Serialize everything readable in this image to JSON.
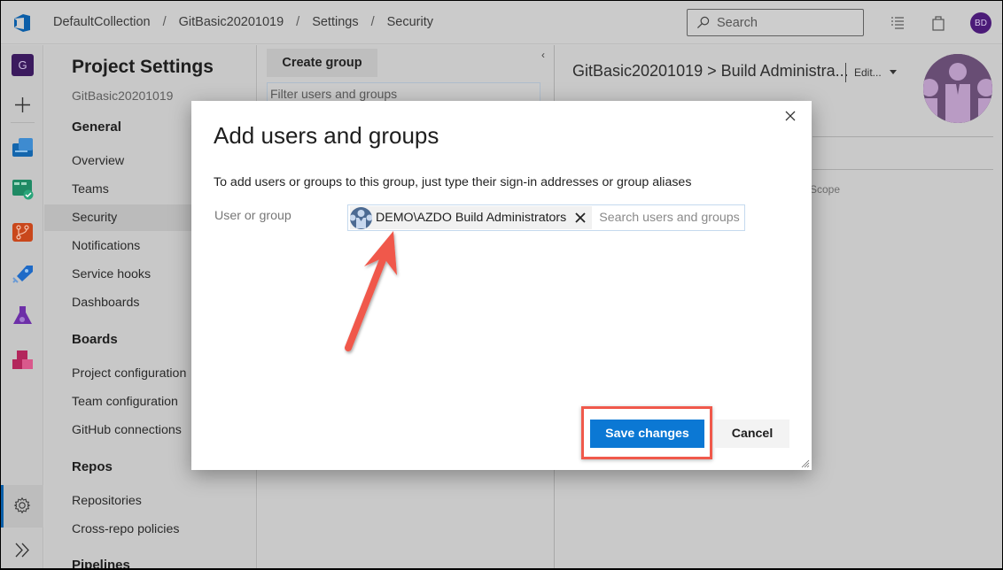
{
  "topbar": {
    "breadcrumbs": [
      "DefaultCollection",
      "GitBasic20201019",
      "Settings",
      "Security"
    ],
    "separator": "/",
    "search_placeholder": "Search",
    "user_initials": "BD"
  },
  "rail": {
    "org_initial": "G",
    "items": [
      "overview",
      "boards",
      "repos",
      "pipelines",
      "test-plans",
      "artifacts"
    ]
  },
  "nav": {
    "title": "Project Settings",
    "project": "GitBasic20201019",
    "sections": [
      {
        "heading": "General",
        "items": [
          "Overview",
          "Teams",
          "Security",
          "Notifications",
          "Service hooks",
          "Dashboards"
        ]
      },
      {
        "heading": "Boards",
        "items": [
          "Project configuration",
          "Team configuration",
          "GitHub connections"
        ]
      },
      {
        "heading": "Repos",
        "items": [
          "Repositories",
          "Cross-repo policies"
        ]
      },
      {
        "heading": "Pipelines",
        "items": []
      }
    ],
    "active_item": "Security"
  },
  "middle": {
    "create_group_label": "Create group",
    "filter_placeholder": "Filter users and groups",
    "collapse_glyph": "‹"
  },
  "right": {
    "group_path": "GitBasic20201019 > Build Administra...",
    "edit_label": "Edit...",
    "column_scope": "Scope"
  },
  "modal": {
    "title": "Add users and groups",
    "description": "To add users or groups to this group, just type their sign-in addresses or group aliases",
    "field_label": "User or group",
    "selected": [
      {
        "name": "DEMO\\AZDO Build Administrators"
      }
    ],
    "search_placeholder": "Search users and groups",
    "save_label": "Save changes",
    "cancel_label": "Cancel"
  },
  "colors": {
    "primary": "#0b78d4",
    "highlight": "#f0594b",
    "avatar_purple": "#4b1b78",
    "group_avatar": "#684d74"
  }
}
